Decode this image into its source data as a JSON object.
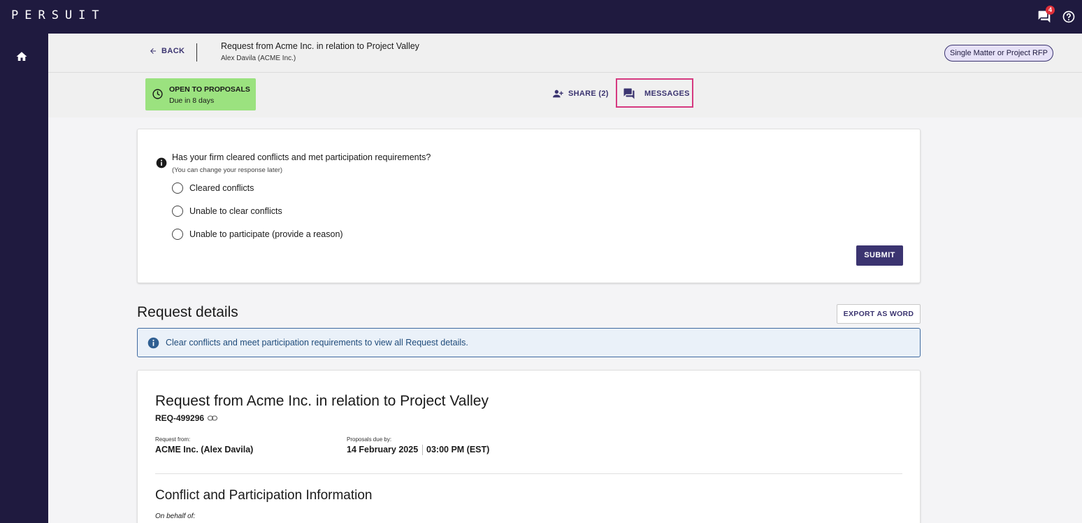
{
  "app": {
    "logo": "PERSUIT"
  },
  "topbar": {
    "notifications_badge": "4",
    "icons": [
      "chat-icon",
      "help-icon"
    ]
  },
  "sidebar": {
    "items": [
      {
        "icon": "home-icon"
      }
    ]
  },
  "header": {
    "back_label": "BACK",
    "title": "Request from Acme Inc. in relation to Project Valley",
    "subtitle": "Alex Davila (ACME Inc.)",
    "type_chip": "Single Matter or Project RFP"
  },
  "status": {
    "title": "OPEN TO PROPOSALS",
    "due": "Due in 8 days",
    "color": "#9be27f"
  },
  "actions": {
    "share_label": "SHARE (2)",
    "messages_label": "MESSAGES"
  },
  "conflicts": {
    "question": "Has your firm cleared conflicts and met participation requirements?",
    "hint": "(You can change your response later)",
    "options": [
      "Cleared conflicts",
      "Unable to clear conflicts",
      "Unable to participate (provide a reason)"
    ],
    "submit_label": "SUBMIT"
  },
  "details": {
    "heading": "Request details",
    "export_label": "EXPORT AS WORD",
    "alert": "Clear conflicts and meet participation requirements to view all Request details."
  },
  "request": {
    "title": "Request from Acme Inc. in relation to Project Valley",
    "id": "REQ-499296",
    "from_label": "Request from:",
    "from_value": "ACME Inc. (Alex Davila)",
    "due_label": "Proposals due by:",
    "due_date": "14 February 2025",
    "due_time": "03:00 PM (EST)",
    "section_title": "Conflict and Participation Information",
    "on_behalf_label": "On behalf of:"
  },
  "colors": {
    "nav_bg": "#1f1a3f",
    "accent": "#3b3470",
    "highlight_border": "#d63a80",
    "status_green": "#9be27f"
  }
}
